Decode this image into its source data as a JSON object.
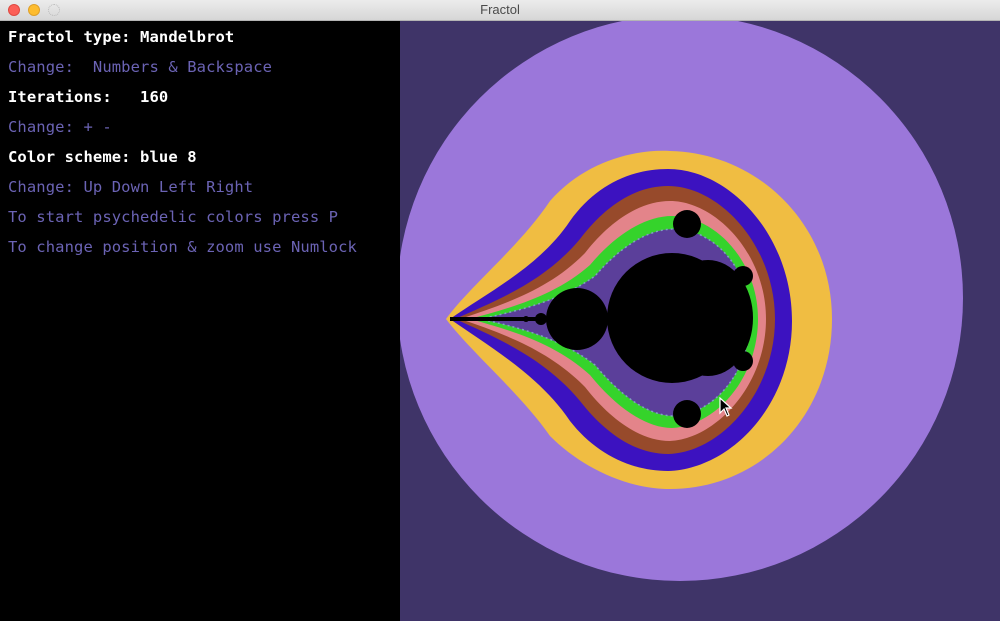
{
  "window": {
    "title": "Fractol"
  },
  "info": {
    "fractol_type": "Fractol type: Mandelbrot",
    "change_type": "Change:  Numbers & Backspace",
    "iterations": "Iterations:   160",
    "change_iterations": "Change: + -",
    "color_scheme": "Color scheme: blue 8",
    "change_colors": "Change: Up Down Left Right",
    "psychedelic_hint": "To start psychedelic colors press P",
    "zoom_hint": "To change position & zoom use Numlock"
  },
  "colors": {
    "background": "#3f3468",
    "outer_band": "#9b77da",
    "yellow_band": "#f0bd42",
    "blue_band": "#3c12c0",
    "brown_band": "#974a2b",
    "pink_band": "#e3848a",
    "green_band": "#35d32b",
    "set_interior": "#000000"
  }
}
